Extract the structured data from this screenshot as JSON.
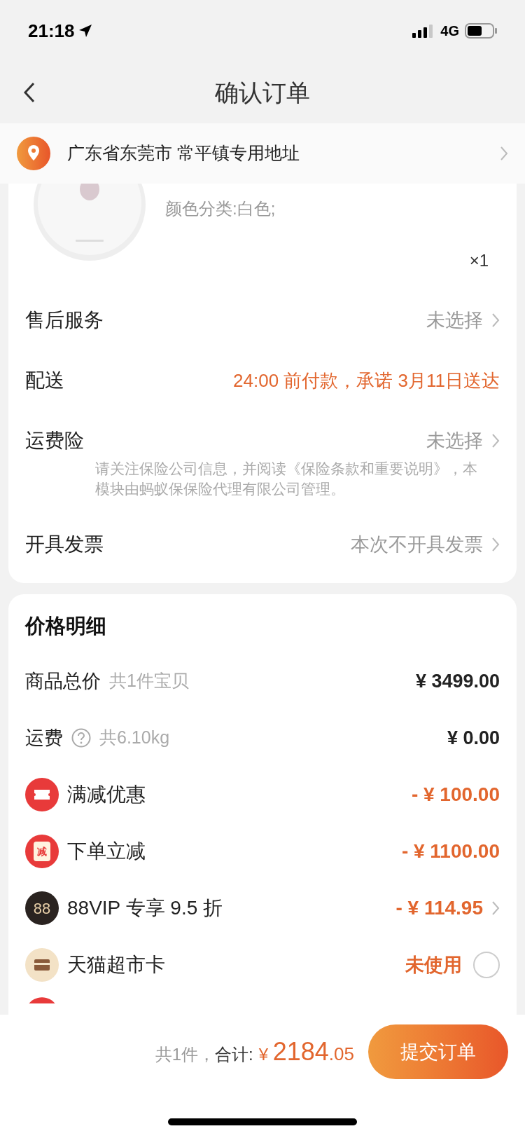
{
  "status_bar": {
    "time": "21:18",
    "network": "4G"
  },
  "nav": {
    "title": "确认订单"
  },
  "address": {
    "text": "广东省东莞市 常平镇专用地址"
  },
  "product": {
    "variant": "颜色分类:白色;",
    "quantity": "×1"
  },
  "order_options": [
    {
      "label": "售后服务",
      "value": "未选择",
      "kind": "muted",
      "chevron": true
    },
    {
      "label": "配送",
      "value": "24:00 前付款，承诺 3月11日送达",
      "kind": "accent",
      "chevron": false
    },
    {
      "label": "运费险",
      "value": "未选择",
      "kind": "muted",
      "chevron": true,
      "note": "请关注保险公司信息，并阅读《保险条款和重要说明》，本模块由蚂蚁保保险代理有限公司管理。"
    },
    {
      "label": "开具发票",
      "value": "本次不开具发票",
      "kind": "muted",
      "chevron": true
    }
  ],
  "price_detail": {
    "title": "价格明细",
    "lines": [
      {
        "kind": "plain",
        "label": "商品总价",
        "sublabel": "共1件宝贝",
        "amount": "¥ 3499.00"
      },
      {
        "kind": "help",
        "label": "运费",
        "sublabel": "共6.10kg",
        "amount": "¥ 0.00"
      },
      {
        "kind": "discount",
        "label": "满减优惠",
        "amount": "- ¥ 100.00",
        "chevron": false
      },
      {
        "kind": "discount",
        "icon_text": "减",
        "label": "下单立减",
        "amount": "- ¥ 1100.00",
        "chevron": false
      },
      {
        "kind": "discount",
        "icon_text": "88",
        "label": "88VIP 专享 9.5 折",
        "amount": "- ¥ 114.95",
        "chevron": true
      },
      {
        "kind": "toggle",
        "label": "天猫超市卡",
        "status": "未使用",
        "checked": false
      }
    ]
  },
  "footer": {
    "count": "共1件，",
    "total_label": "合计:",
    "currency": "¥",
    "amount_integer": "2184",
    "amount_decimal": ".05",
    "submit": "提交订单"
  }
}
